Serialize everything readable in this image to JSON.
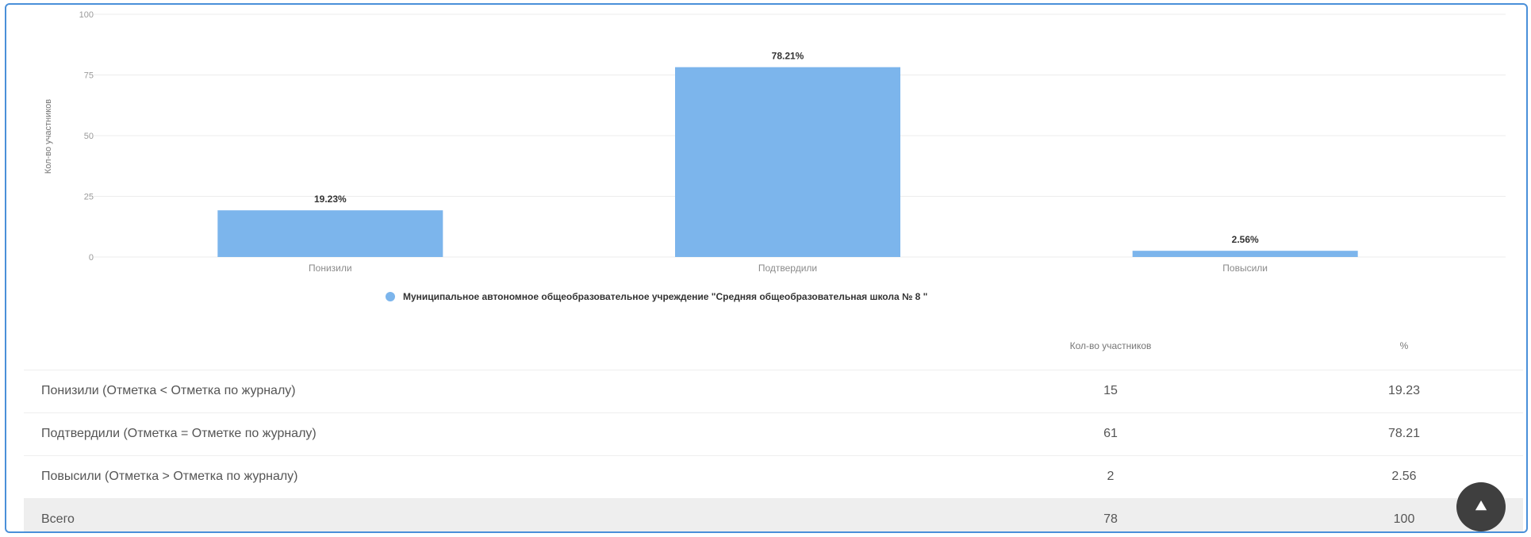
{
  "chart_data": {
    "type": "bar",
    "categories": [
      "Понизили",
      "Подтвердили",
      "Повысили"
    ],
    "series": [
      {
        "name": "Муниципальное автономное общеобразовательное учреждение \"Средняя общеобразовательная школа № 8 \"",
        "values": [
          19.23,
          78.21,
          2.56
        ],
        "labels": [
          "19.23%",
          "78.21%",
          "2.56%"
        ]
      }
    ],
    "ylabel": "Кол-во участников",
    "ylim": [
      0,
      100
    ],
    "yticks": [
      "0",
      "25",
      "50",
      "75",
      "100"
    ],
    "grid": true,
    "legend_position": "bottom",
    "color": "#7cb5ec"
  },
  "table": {
    "headers": [
      "",
      "Кол-во участников",
      "%"
    ],
    "rows": [
      {
        "label": "Понизили (Отметка < Отметка по журналу)",
        "count": "15",
        "pct": "19.23"
      },
      {
        "label": "Подтвердили (Отметка = Отметке по журналу)",
        "count": "61",
        "pct": "78.21"
      },
      {
        "label": "Повысили (Отметка > Отметка по журналу)",
        "count": "2",
        "pct": "2.56"
      }
    ],
    "total": {
      "label": "Всего",
      "count": "78",
      "pct": "100"
    }
  },
  "scroll_top_icon": "double-chevron-up-icon"
}
